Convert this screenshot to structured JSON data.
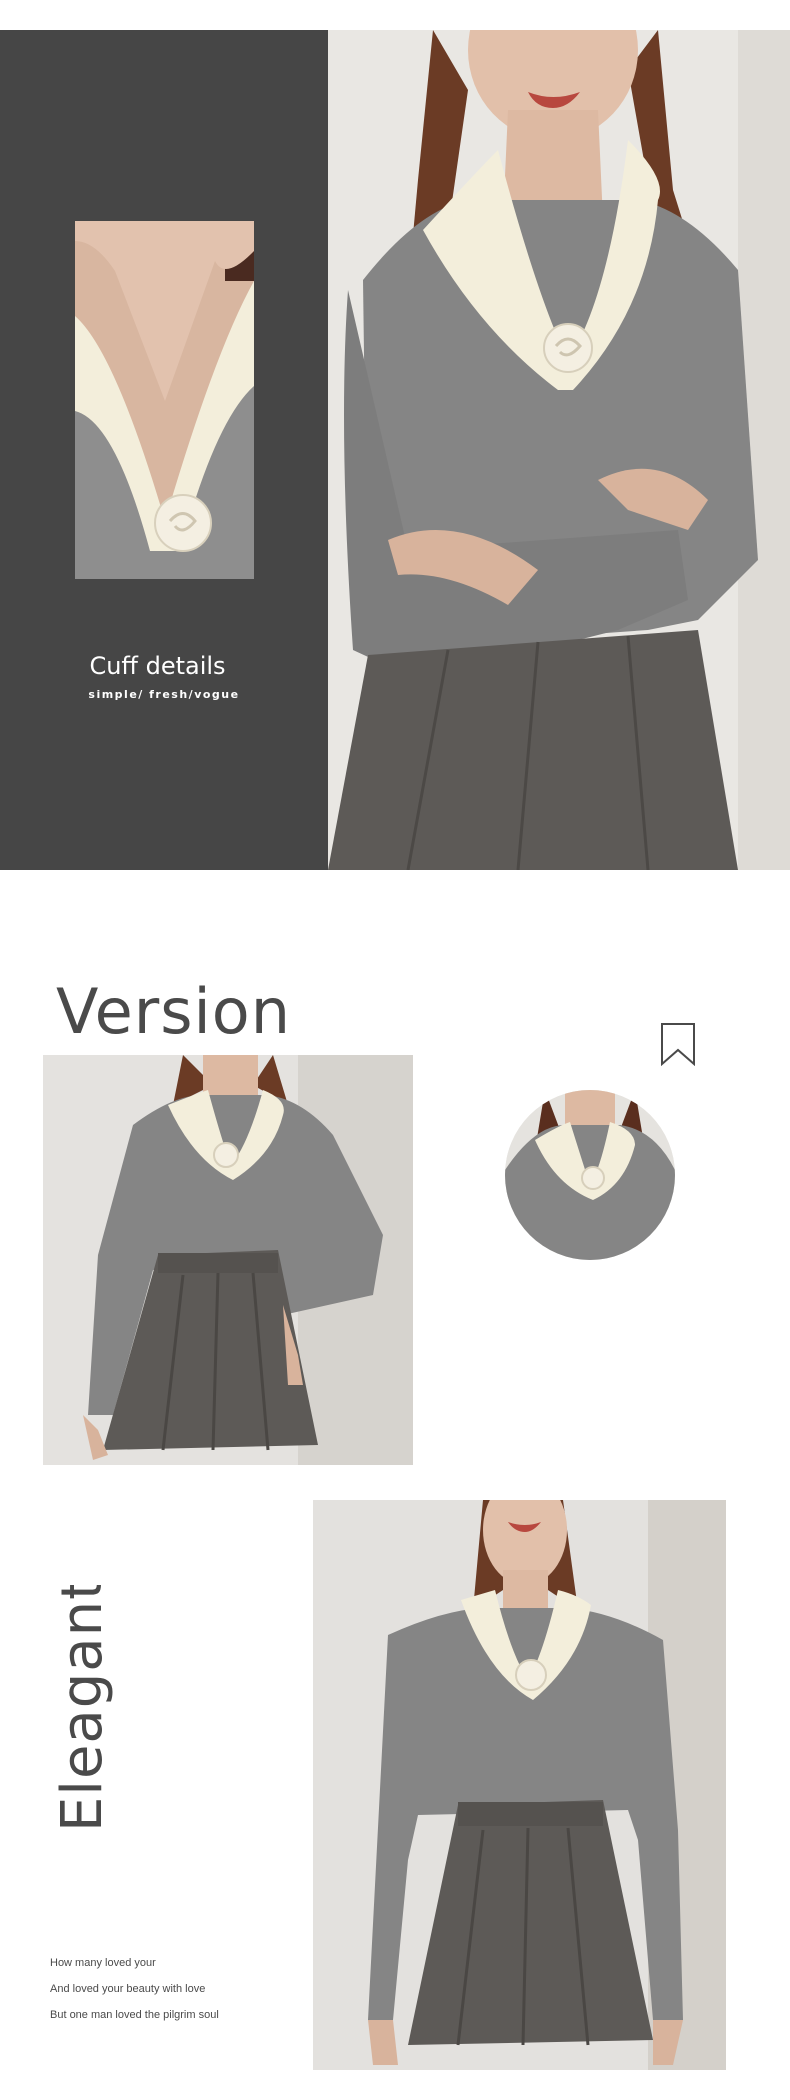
{
  "detail": {
    "title": "Cuff details",
    "subtitle": "simple/ fresh/vogue"
  },
  "version": {
    "title": "Version"
  },
  "elegant": {
    "title": "Eleagant",
    "lines": [
      "How many loved your",
      "And loved your beauty with love",
      "But one man loved the pilgrim soul"
    ]
  },
  "colors": {
    "dark_panel": "#464646",
    "sweater": "#858585",
    "collar": "#f3eedb",
    "skirt": "#5d5a57",
    "text": "#4a4a4a"
  },
  "icons": {
    "bookmark": "bookmark-icon"
  }
}
